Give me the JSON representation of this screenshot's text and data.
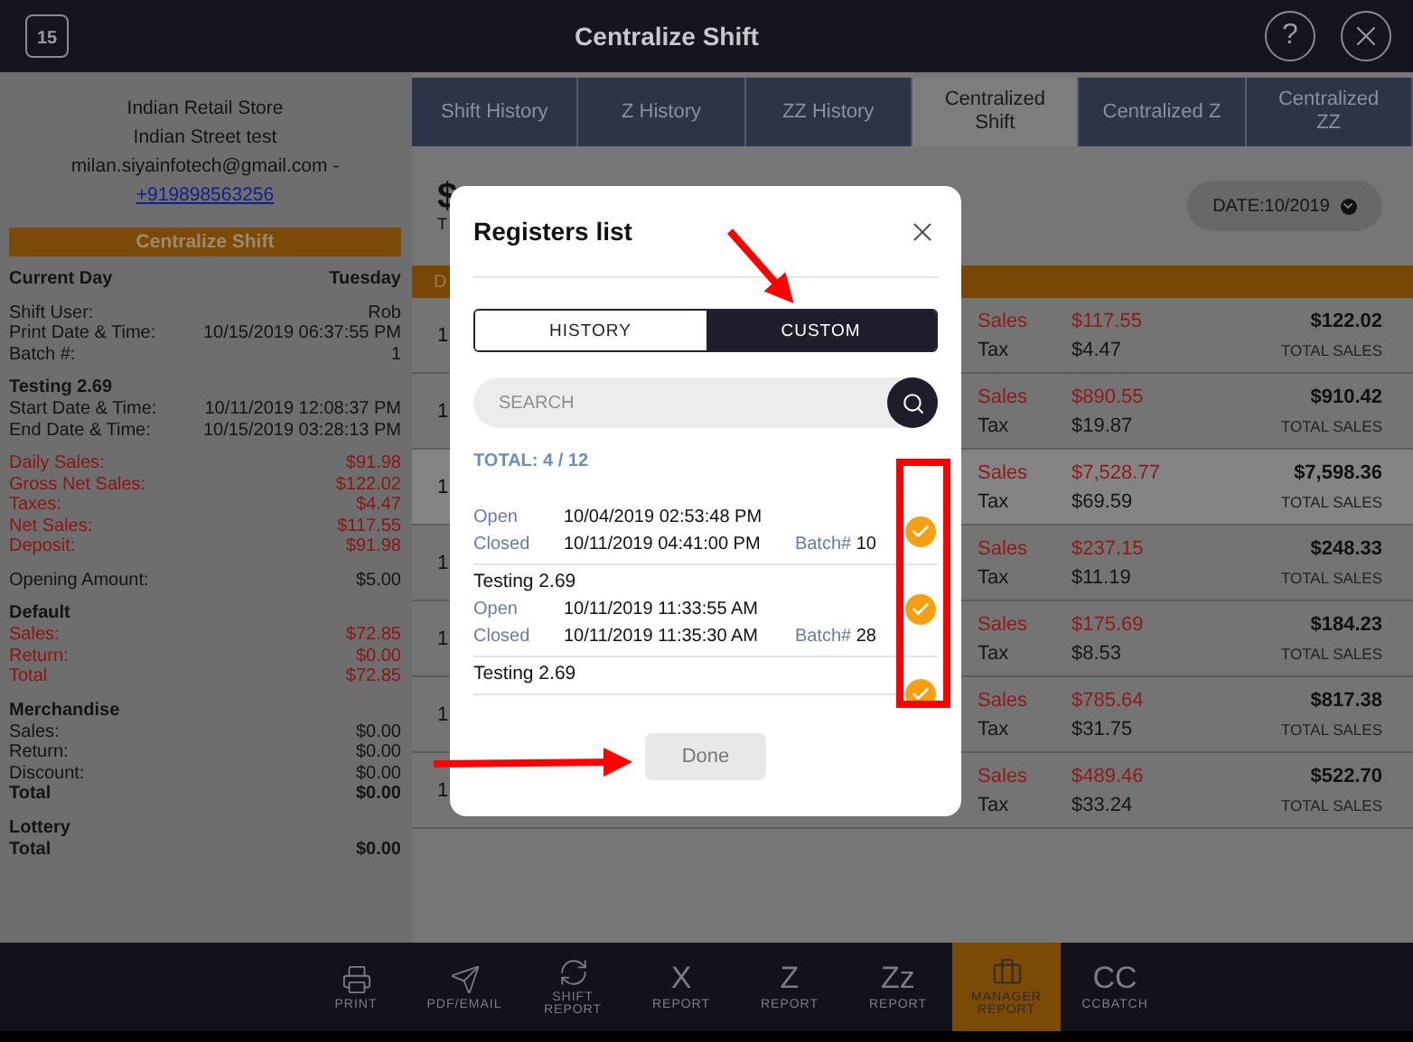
{
  "top_bar": {
    "calendar_day": "15",
    "title": "Centralize Shift",
    "help": "?"
  },
  "receipt": {
    "store": "Indian Retail Store",
    "street": "Indian Street test",
    "email": "milan.siyainfotech@gmail.com -",
    "phone": "+919898563256",
    "banner": "Centralize Shift",
    "sections": [
      {
        "rows": [
          {
            "label": "Current Day",
            "value": "Tuesday",
            "kind": "total"
          }
        ]
      },
      {
        "rows": [
          {
            "label": "Shift User:",
            "value": "Rob",
            "kind": "plain"
          },
          {
            "label": "Print Date & Time:",
            "value": "10/15/2019 06:37:55 PM",
            "kind": "plain"
          },
          {
            "label": "Batch #:",
            "value": "1",
            "kind": "plain"
          }
        ]
      },
      {
        "title": "Testing 2.69",
        "rows": [
          {
            "label": "Start Date & Time:",
            "value": "10/11/2019 12:08:37 PM",
            "kind": "plain"
          },
          {
            "label": "End Date & Time:",
            "value": "10/15/2019 03:28:13 PM",
            "kind": "plain"
          }
        ]
      },
      {
        "rows": [
          {
            "label": "Daily Sales:",
            "value": "$91.98",
            "kind": "alert"
          },
          {
            "label": "Gross Net Sales:",
            "value": "$122.02",
            "kind": "alert"
          },
          {
            "label": "Taxes:",
            "value": "$4.47",
            "kind": "alert"
          },
          {
            "label": "Net Sales:",
            "value": "$117.55",
            "kind": "alert"
          },
          {
            "label": "Deposit:",
            "value": "$91.98",
            "kind": "alert"
          }
        ]
      },
      {
        "rows": [
          {
            "label": "Opening Amount:",
            "value": "$5.00",
            "kind": "plain"
          }
        ]
      },
      {
        "title": "Default",
        "rows": [
          {
            "label": "Sales:",
            "value": "$72.85",
            "kind": "alert"
          },
          {
            "label": "Return:",
            "value": "$0.00",
            "kind": "alert"
          },
          {
            "label": "Total",
            "value": "$72.85",
            "kind": "alert"
          }
        ]
      },
      {
        "title": "Merchandise",
        "rows": [
          {
            "label": "Sales:",
            "value": "$0.00",
            "kind": "plain"
          },
          {
            "label": "Return:",
            "value": "$0.00",
            "kind": "plain"
          },
          {
            "label": "Discount:",
            "value": "$0.00",
            "kind": "plain"
          },
          {
            "label": "Total",
            "value": "$0.00",
            "kind": "total"
          }
        ]
      },
      {
        "title": "Lottery",
        "rows": [
          {
            "label": "Total",
            "value": "$0.00",
            "kind": "total"
          }
        ]
      }
    ]
  },
  "tabs": [
    {
      "label": "Shift History",
      "selected": false
    },
    {
      "label": "Z History",
      "selected": false
    },
    {
      "label": "ZZ History",
      "selected": false
    },
    {
      "label": "Centralized Shift",
      "selected": true
    },
    {
      "label": "Centralized Z",
      "selected": false
    },
    {
      "label": "Centralized ZZ",
      "selected": false
    }
  ],
  "content": {
    "heading": "$",
    "subheading": "T",
    "date_filter": "DATE:10/2019",
    "bar_text": "D",
    "rows": [
      {
        "column_1": "1",
        "sales_label": "Sales",
        "sales": "$117.55",
        "tax_label": "Tax",
        "tax": "$4.47",
        "total": "$122.02",
        "total_label": "TOTAL SALES",
        "highlighted": false
      },
      {
        "column_1": "1",
        "sales_label": "Sales",
        "sales": "$890.55",
        "tax_label": "Tax",
        "tax": "$19.87",
        "total": "$910.42",
        "total_label": "TOTAL SALES",
        "highlighted": false
      },
      {
        "column_1": "1",
        "sales_label": "Sales",
        "sales": "$7,528.77",
        "tax_label": "Tax",
        "tax": "$69.59",
        "total": "$7,598.36",
        "total_label": "TOTAL SALES",
        "highlighted": true
      },
      {
        "column_1": "1",
        "sales_label": "Sales",
        "sales": "$237.15",
        "tax_label": "Tax",
        "tax": "$11.19",
        "total": "$248.33",
        "total_label": "TOTAL SALES",
        "highlighted": false
      },
      {
        "column_1": "1",
        "sales_label": "Sales",
        "sales": "$175.69",
        "tax_label": "Tax",
        "tax": "$8.53",
        "total": "$184.23",
        "total_label": "TOTAL SALES",
        "highlighted": false
      },
      {
        "column_1": "1",
        "sales_label": "Sales",
        "sales": "$785.64",
        "tax_label": "Tax",
        "tax": "$31.75",
        "total": "$817.38",
        "total_label": "TOTAL SALES",
        "highlighted": false
      },
      {
        "column_1": "1",
        "sales_label": "Sales",
        "sales": "$489.46",
        "tax_label": "Tax",
        "tax": "$33.24",
        "total": "$522.70",
        "total_label": "TOTAL SALES",
        "highlighted": false
      }
    ]
  },
  "dialog": {
    "title": "Registers list",
    "modes": [
      {
        "label": "HISTORY",
        "selected": false
      },
      {
        "label": "CUSTOM",
        "selected": true
      }
    ],
    "search": {
      "placeholder": "SEARCH"
    },
    "total": "TOTAL: 4 / 12",
    "registers": [
      {
        "open_label": "Open",
        "open": "10/04/2019 02:53:48 PM",
        "closed_label": "Closed",
        "closed": "10/11/2019 04:41:00 PM",
        "batch_label": "Batch#",
        "batch": "10",
        "checked": true
      },
      {
        "name": "Testing 2.69",
        "open_label": "Open",
        "open": "10/11/2019 11:33:55 AM",
        "closed_label": "Closed",
        "closed": "10/11/2019 11:35:30 AM",
        "batch_label": "Batch#",
        "batch": "28",
        "checked": true
      },
      {
        "name": "Testing 2.69",
        "checked": true
      }
    ],
    "done": "Done"
  },
  "toolbar": [
    {
      "kind": "print",
      "label": "PRINT",
      "selected": false
    },
    {
      "kind": "send",
      "label": "PDF/EMAIL",
      "selected": false
    },
    {
      "kind": "cycle",
      "label": "SHIFT REPORT",
      "selected": false
    },
    {
      "kind": "letters",
      "glyph": "X",
      "label": "REPORT",
      "selected": false
    },
    {
      "kind": "letters",
      "glyph": "Z",
      "label": "REPORT",
      "selected": false
    },
    {
      "kind": "letters",
      "glyph": "Zz",
      "label": "REPORT",
      "selected": false
    },
    {
      "kind": "briefcase",
      "label": "MANAGER REPORT",
      "selected": true
    },
    {
      "kind": "letters",
      "glyph": "CC",
      "label": "CCBATCH",
      "selected": false
    }
  ]
}
